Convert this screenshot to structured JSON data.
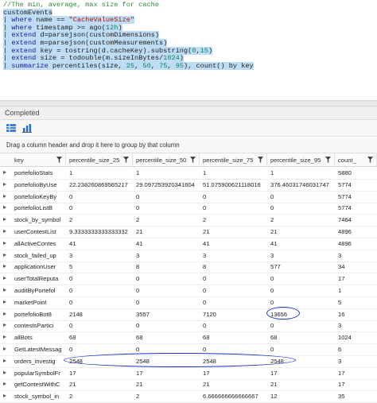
{
  "query": {
    "comment": "//The min, average, max size for cache",
    "lines": [
      {
        "parts": [
          {
            "t": "customEvents",
            "c": "c-id"
          }
        ]
      },
      {
        "parts": [
          {
            "t": "| ",
            "c": "c-id"
          },
          {
            "t": "where",
            "c": "c-kw"
          },
          {
            "t": " name == ",
            "c": "c-id"
          },
          {
            "t": "\"CacheValueSize\"",
            "c": "c-str"
          }
        ]
      },
      {
        "parts": [
          {
            "t": "| ",
            "c": "c-id"
          },
          {
            "t": "where",
            "c": "c-kw"
          },
          {
            "t": " timestamp >= ago(",
            "c": "c-id"
          },
          {
            "t": "12h",
            "c": "c-num"
          },
          {
            "t": ")",
            "c": "c-id"
          }
        ]
      },
      {
        "parts": [
          {
            "t": "| ",
            "c": "c-id"
          },
          {
            "t": "extend",
            "c": "c-kw"
          },
          {
            "t": " d=parsejson(customDimensions)",
            "c": "c-id"
          }
        ]
      },
      {
        "parts": [
          {
            "t": "| ",
            "c": "c-id"
          },
          {
            "t": "extend",
            "c": "c-kw"
          },
          {
            "t": " m=parsejson(customMeasurements)",
            "c": "c-id"
          }
        ]
      },
      {
        "parts": [
          {
            "t": "| ",
            "c": "c-id"
          },
          {
            "t": "extend",
            "c": "c-kw"
          },
          {
            "t": " key = tostring(d.cacheKey).substring(",
            "c": "c-id"
          },
          {
            "t": "0",
            "c": "c-num"
          },
          {
            "t": ",",
            "c": "c-id"
          },
          {
            "t": "15",
            "c": "c-num"
          },
          {
            "t": ")",
            "c": "c-id"
          }
        ]
      },
      {
        "parts": [
          {
            "t": "| ",
            "c": "c-id"
          },
          {
            "t": "extend",
            "c": "c-kw"
          },
          {
            "t": " size = todouble(m.sizeInBytes/",
            "c": "c-id"
          },
          {
            "t": "1024",
            "c": "c-num"
          },
          {
            "t": ")",
            "c": "c-id"
          }
        ]
      },
      {
        "parts": [
          {
            "t": "| ",
            "c": "c-id"
          },
          {
            "t": "summarize",
            "c": "c-kw"
          },
          {
            "t": " percentiles(size, ",
            "c": "c-id"
          },
          {
            "t": "25",
            "c": "c-num"
          },
          {
            "t": ", ",
            "c": "c-id"
          },
          {
            "t": "50",
            "c": "c-num"
          },
          {
            "t": ", ",
            "c": "c-id"
          },
          {
            "t": "75",
            "c": "c-num"
          },
          {
            "t": ", ",
            "c": "c-id"
          },
          {
            "t": "95",
            "c": "c-num"
          },
          {
            "t": "), count() by key",
            "c": "c-id"
          }
        ]
      }
    ]
  },
  "status": {
    "text": "Completed"
  },
  "view_buttons": [
    {
      "name": "table-view-icon"
    },
    {
      "name": "chart-view-icon"
    }
  ],
  "group_hint": "Drag a column header and drop it here to group by that column",
  "columns": [
    "key",
    "percentile_size_25",
    "percentile_size_50",
    "percentile_size_75",
    "percentile_size_95",
    "count_"
  ],
  "rows": [
    [
      "portefolioStats",
      "1",
      "1",
      "1",
      "1",
      "5880"
    ],
    [
      "portefolioByUse",
      "22.238260869565217",
      "29.097253920341604",
      "51.075900621118016",
      "376.46031746031747",
      "5774"
    ],
    [
      "portefolioKeyBy",
      "0",
      "0",
      "0",
      "0",
      "5774"
    ],
    [
      "portefolioListB",
      "0",
      "0",
      "0",
      "0",
      "5774"
    ],
    [
      "stock_by_symbol",
      "2",
      "2",
      "2",
      "2",
      "7464"
    ],
    [
      "userContestList",
      "9.3333333333333332",
      "21",
      "21",
      "21",
      "4896"
    ],
    [
      "allActiveContes",
      "41",
      "41",
      "41",
      "41",
      "4896"
    ],
    [
      "stock_failed_up",
      "3",
      "3",
      "3",
      "3",
      "3"
    ],
    [
      "applicationUser",
      "5",
      "8",
      "8",
      "577",
      "34"
    ],
    [
      "userTotalReputa",
      "0",
      "0",
      "0",
      "0",
      "17"
    ],
    [
      "auditByPortefol",
      "0",
      "0",
      "0",
      "0",
      "1"
    ],
    [
      "marketPoint",
      "0",
      "0",
      "0",
      "0",
      "5"
    ],
    [
      "portefolioBot8",
      "2148",
      "3557",
      "7120",
      "13656",
      "16"
    ],
    [
      "contestsPartici",
      "0",
      "0",
      "0",
      "0",
      "3"
    ],
    [
      "allBots",
      "68",
      "68",
      "68",
      "68",
      "1024"
    ],
    [
      "GetLatestMessag",
      "0",
      "0",
      "0",
      "0",
      "6"
    ],
    [
      "orders_investig",
      "2548",
      "2548",
      "2548",
      "2548",
      "3"
    ],
    [
      "popularSymbolFr",
      "17",
      "17",
      "17",
      "17",
      "17"
    ],
    [
      "getContestWithC",
      "21",
      "21",
      "21",
      "21",
      "17"
    ],
    [
      "stock_symbol_in",
      "2",
      "2",
      "6.666666666666667",
      "12",
      "35"
    ]
  ]
}
